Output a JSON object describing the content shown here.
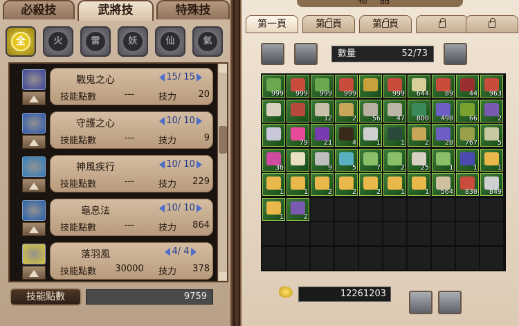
{
  "skill_panel": {
    "tabs": [
      "必殺技",
      "武將技",
      "特殊技"
    ],
    "active_tab": 1,
    "categories": [
      {
        "label": "全",
        "icon": "all-category-icon",
        "active": true
      },
      {
        "label": "火",
        "icon": "fire-category-icon",
        "active": false
      },
      {
        "label": "雷",
        "icon": "thunder-category-icon",
        "active": false
      },
      {
        "label": "妖",
        "icon": "demon-category-icon",
        "active": false
      },
      {
        "label": "仙",
        "icon": "immortal-category-icon",
        "active": false
      },
      {
        "label": "氣",
        "icon": "qi-category-icon",
        "active": false
      }
    ],
    "skills": [
      {
        "name": "戰鬼之心",
        "level": "15/ 15",
        "points_label": "技能點數",
        "points": "---",
        "power_label": "技力",
        "power": "20",
        "icon_color": "#3c3f9c"
      },
      {
        "name": "守護之心",
        "level": "10/ 10",
        "points_label": "技能點數",
        "points": "---",
        "power_label": "技力",
        "power": "9",
        "icon_color": "#2a58b0"
      },
      {
        "name": "神風疾行",
        "level": "10/ 10",
        "points_label": "技能點數",
        "points": "---",
        "power_label": "技力",
        "power": "229",
        "icon_color": "#2b7fc0"
      },
      {
        "name": "龜息法",
        "level": "10/ 10",
        "points_label": "技能點數",
        "points": "---",
        "power_label": "技力",
        "power": "864",
        "icon_color": "#1f5fae"
      },
      {
        "name": "落羽風",
        "level": "4/ 4",
        "points_label": "技能點數",
        "points": "30000",
        "power_label": "技力",
        "power": "378",
        "icon_color": "#d6c43a"
      }
    ],
    "skill_points_label": "技能點數",
    "skill_points_value": "9759"
  },
  "inventory": {
    "title": "物品",
    "tabs": [
      {
        "label": "第一頁",
        "locked": false,
        "active": true
      },
      {
        "label": "第頁",
        "locked": true,
        "active": false
      },
      {
        "label": "第頁",
        "locked": true,
        "active": false
      },
      {
        "label": "",
        "locked": true,
        "active": false
      },
      {
        "label": "",
        "locked": true,
        "active": false
      }
    ],
    "quantity_label": "數量",
    "quantity_value": "52/73",
    "gold": "12261203",
    "items": [
      "999",
      "999",
      "999",
      "999",
      "",
      "999",
      "644",
      "89",
      "44",
      "963",
      "",
      "",
      "12",
      "2",
      "56",
      "47",
      "800",
      "498",
      "66",
      "2",
      "",
      "79",
      "21",
      "4",
      "1",
      "1",
      "2",
      "20",
      "767",
      "5",
      "36",
      "",
      "9",
      "5",
      "7",
      "2",
      "25",
      "1",
      "1",
      "1",
      "1",
      "1",
      "2",
      "2",
      "2",
      "1",
      "1",
      "564",
      "830",
      "849",
      "1",
      "2",
      "",
      "",
      "",
      "",
      "",
      "",
      "",
      "",
      "",
      "",
      "",
      "",
      "",
      "",
      "",
      "",
      "",
      "",
      "",
      "",
      "",
      "",
      "",
      "",
      "",
      "",
      "",
      ""
    ],
    "filled_slots": 52,
    "item_colors": [
      "#6aa84f",
      "#c94b3b",
      "#6aa84f",
      "#c94b3b",
      "#c7a13a",
      "#c94b3b",
      "#d7cf9a",
      "#c94b3b",
      "#9a2f2f",
      "#c94b3b",
      "#d9d2c0",
      "#b84a3c",
      "#c9c0aa",
      "#c9a65a",
      "#b8b0a0",
      "#bdb6a6",
      "#3a8a5a",
      "#6c5ec4",
      "#7aa02f",
      "#7a5ab0",
      "#c8c8d8",
      "#e84a9a",
      "#7a3ab0",
      "#3a2a1a",
      "#cfcfcf",
      "#2a4a3a",
      "#c9a65a",
      "#6c5ec4",
      "#9aa04a",
      "#c8c8a0",
      "#d04aa0",
      "#e8e0c0",
      "#bfbfbf",
      "#5ab0c0",
      "#8abf6a",
      "#8abf6a",
      "#d8d0c0",
      "#8abf6a",
      "#4a4ab0",
      "#e8b84a",
      "#e8b84a",
      "#e8b84a",
      "#e8b84a",
      "#e8b84a",
      "#e8b84a",
      "#e8b84a",
      "#e8b84a",
      "#cfc0a0",
      "#c94b3b",
      "#cfcfcf",
      "#e8b84a",
      "#7a5ab0"
    ]
  }
}
